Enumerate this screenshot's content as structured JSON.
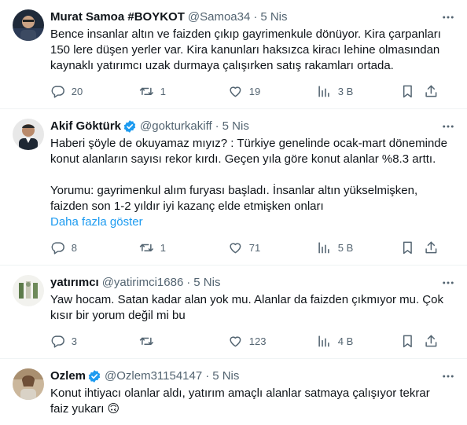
{
  "tweets": [
    {
      "name": "Murat Samoa #BOYKOT",
      "handle": "@Samoa34",
      "dot": "·",
      "time": "5 Nis",
      "verified": false,
      "text": "Bence insanlar altın ve faizden çıkıp gayrimenkule dönüyor. Kira çarpanları\n150 lere düşen yerler var. Kira kanunları haksızca kiracı lehine olmasından\nkaynaklı yatırımcı uzak durmaya çalışırken satış rakamları ortada.",
      "show_more": "",
      "replies": "20",
      "retweets": "1",
      "likes": "19",
      "views": "3 B"
    },
    {
      "name": "Akif Göktürk",
      "handle": "@gokturkakiff",
      "dot": "·",
      "time": "5 Nis",
      "verified": true,
      "text": "Haberi şöyle de okuyamaz mıyız? : Türkiye genelinde ocak-mart döneminde\nkonut alanların sayısı rekor kırdı. Geçen yıla göre konut alanlar %8.3 arttı.\n\nYorumu: gayrimenkul alım furyası başladı. İnsanlar altın yükselmişken,\nfaizden son 1-2 yıldır iyi kazanç elde etmişken onları",
      "show_more": "Daha fazla göster",
      "replies": "8",
      "retweets": "1",
      "likes": "71",
      "views": "5 B"
    },
    {
      "name": "yatırımcı",
      "handle": "@yatirimci1686",
      "dot": "·",
      "time": "5 Nis",
      "verified": false,
      "text": "Yaw hocam. Satan kadar alan yok mu. Alanlar da faizden çıkmıyor mu. Çok\nkısır bir yorum değil mi bu",
      "show_more": "",
      "replies": "3",
      "retweets": "",
      "likes": "123",
      "views": "4 B"
    },
    {
      "name": "Ozlem",
      "handle": "@Ozlem31154147",
      "dot": "·",
      "time": "5 Nis",
      "verified": true,
      "text": "Konut ihtiyacı olanlar aldı, yatırım amaçlı alanlar satmaya çalışıyor tekrar\nfaiz yukarı 🙃",
      "show_more": "",
      "replies": "",
      "retweets": "",
      "likes": "",
      "views": ""
    }
  ],
  "colors": {
    "text": "#0f1419",
    "secondary": "#536471",
    "link": "#1d9bf0",
    "border": "#eff3f4"
  }
}
